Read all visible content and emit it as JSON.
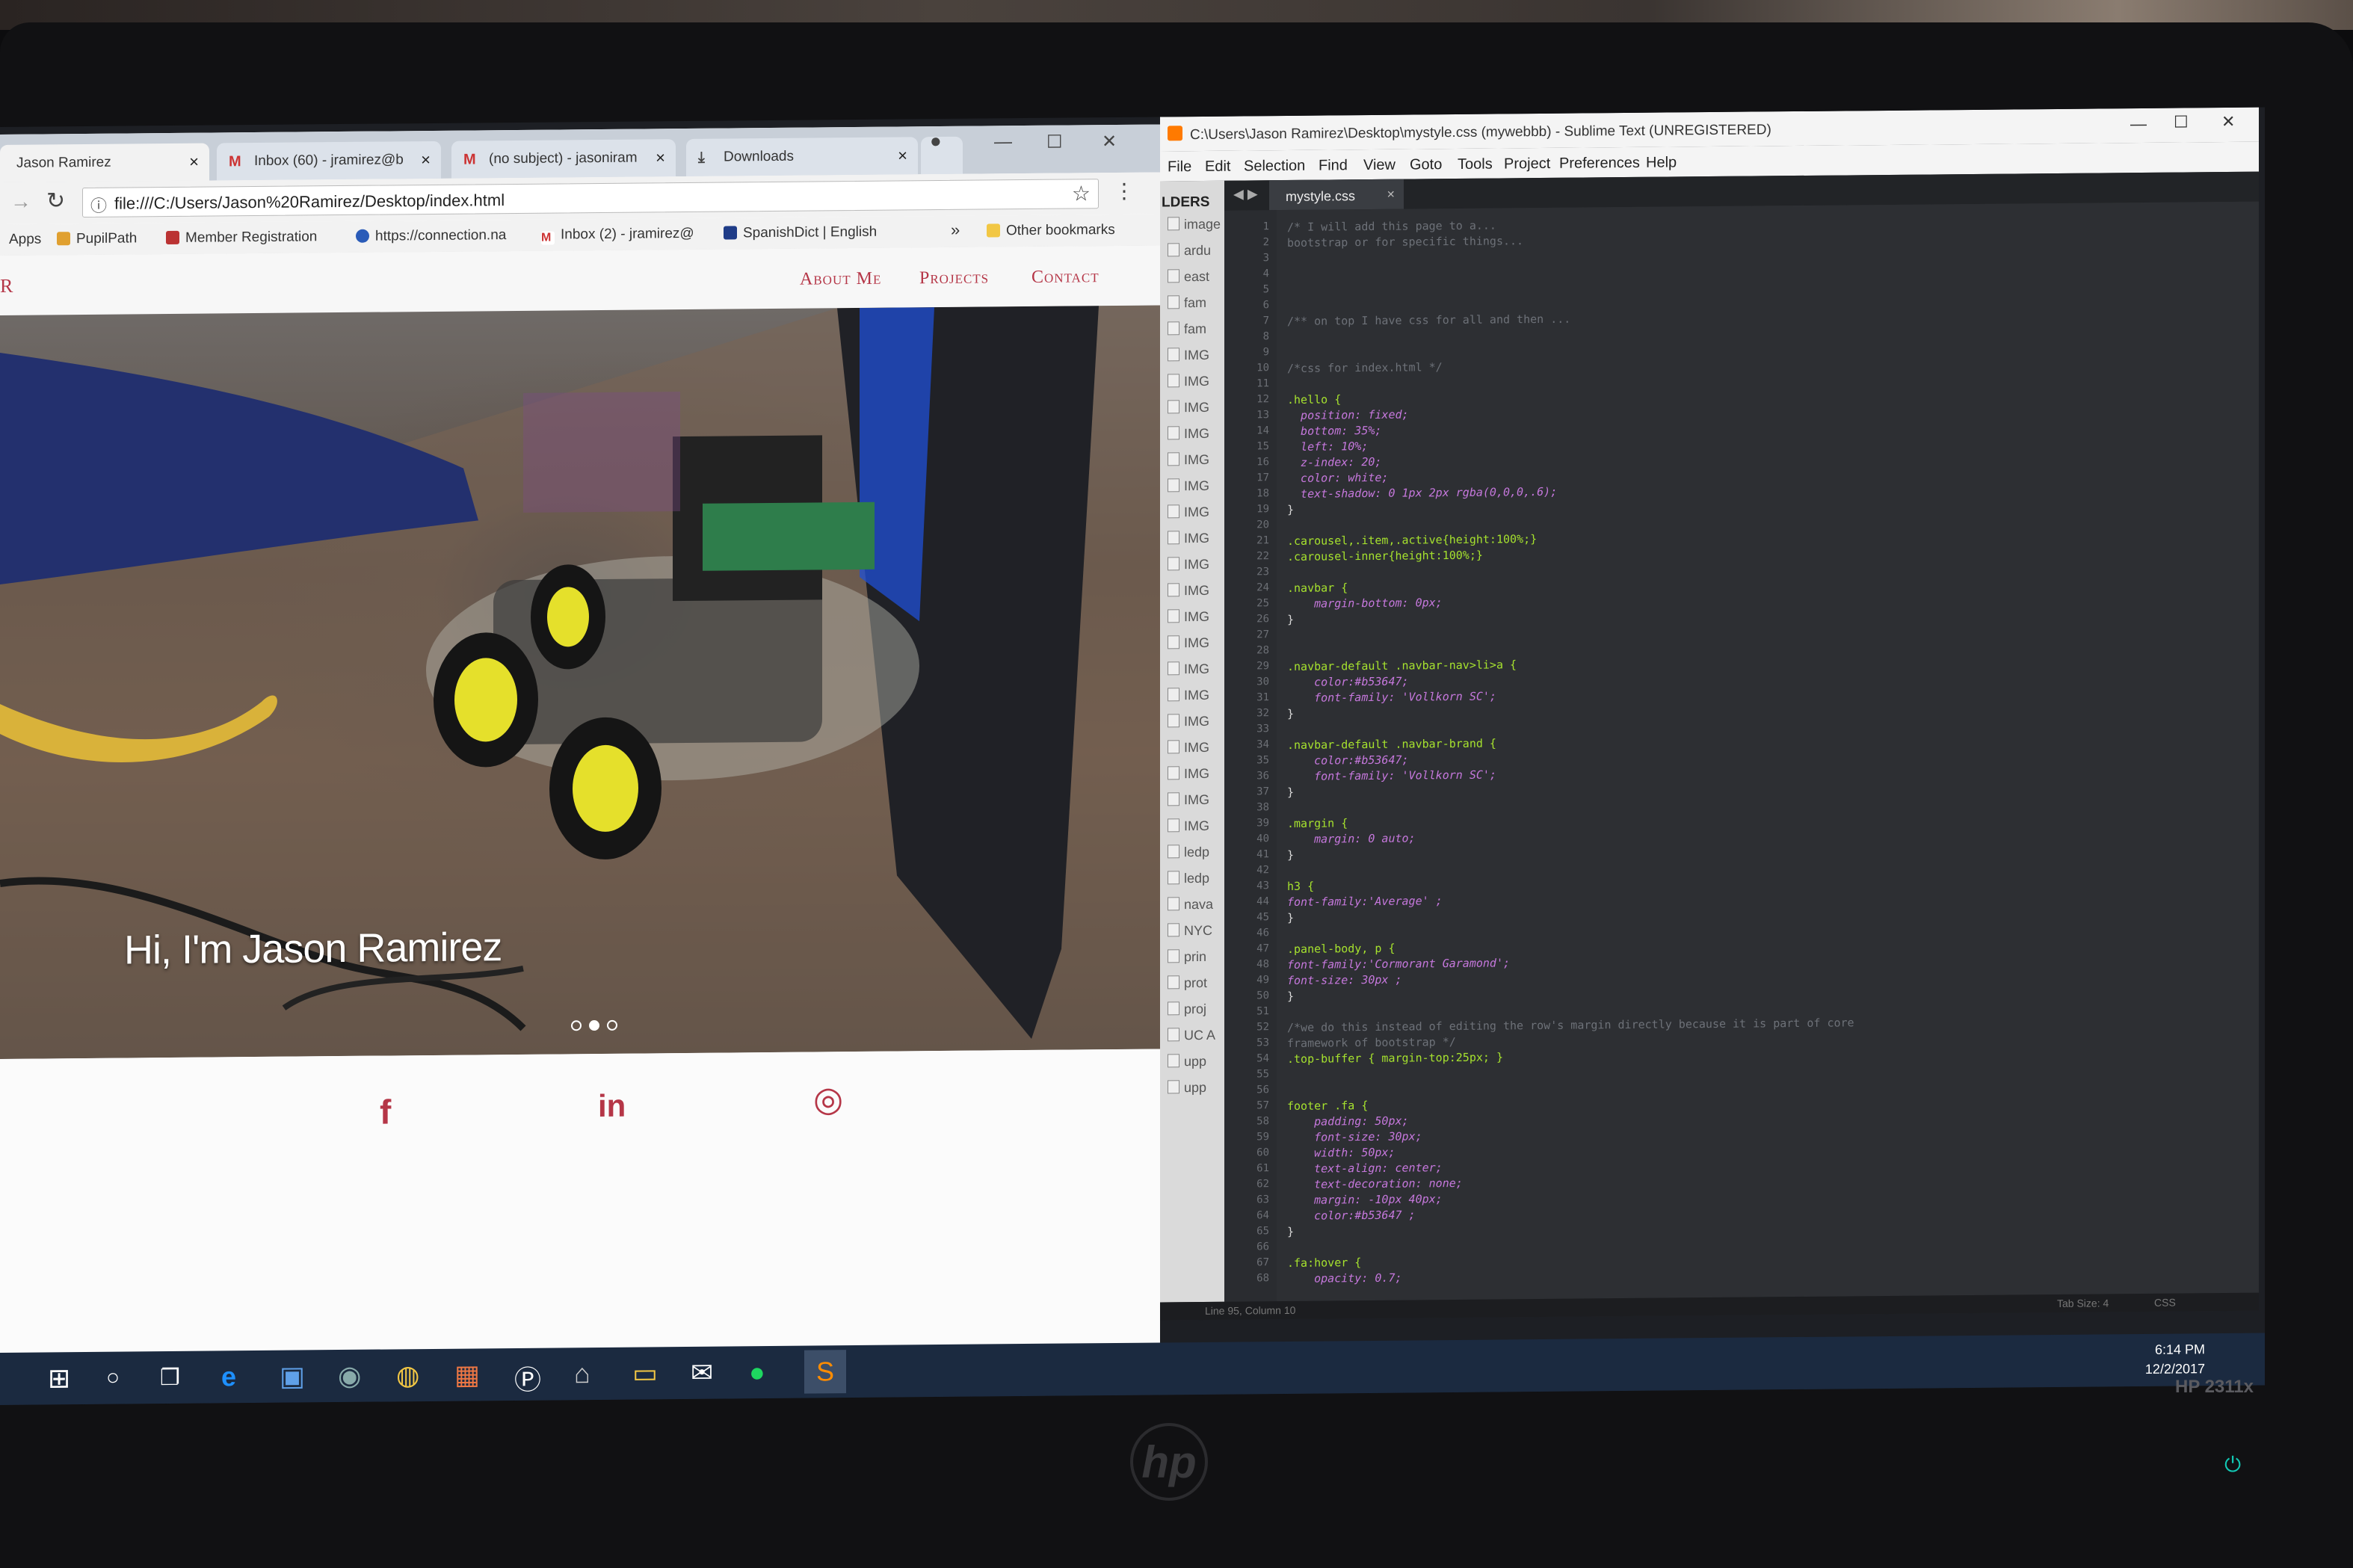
{
  "chrome": {
    "tabs": [
      {
        "label": "Jason Ramirez",
        "favicon": "page-icon",
        "active": true
      },
      {
        "label": "Inbox (60) - jramirez@b",
        "favicon": "gmail-icon"
      },
      {
        "label": "(no subject) - jasoniram",
        "favicon": "gmail-icon"
      },
      {
        "label": "Downloads",
        "favicon": "download-icon"
      }
    ],
    "url": "file:///C:/Users/Jason%20Ramirez/Desktop/index.html",
    "bookmarks": [
      {
        "label": "Apps"
      },
      {
        "label": "PupilPath"
      },
      {
        "label": "Member Registration"
      },
      {
        "label": "https://connection.na"
      },
      {
        "label": "Inbox (2) - jramirez@"
      },
      {
        "label": "SpanishDict | English"
      },
      {
        "label": "Other bookmarks"
      }
    ],
    "more_bookmarks": "»"
  },
  "site": {
    "brand": "R",
    "nav": [
      "About Me",
      "Projects",
      "Contact"
    ],
    "hero_caption": "Hi, I'm Jason Ramirez",
    "carousel_dots": 3,
    "carousel_active": 1,
    "social": [
      "facebook-icon",
      "linkedin-icon",
      "instagram-icon"
    ],
    "social_glyphs": [
      "f",
      "in",
      "◎"
    ]
  },
  "sublime": {
    "title": "C:\\Users\\Jason Ramirez\\Desktop\\mystyle.css (mywebbb) - Sublime Text (UNREGISTERED)",
    "menu": [
      "File",
      "Edit",
      "Selection",
      "Find",
      "View",
      "Goto",
      "Tools",
      "Project",
      "Preferences",
      "Help"
    ],
    "sidebar_header": "LDERS",
    "sidebar_items": [
      "image",
      "ardu",
      "east",
      "fam",
      "fam",
      "IMG",
      "IMG",
      "IMG",
      "IMG",
      "IMG",
      "IMG",
      "IMG",
      "IMG",
      "IMG",
      "IMG",
      "IMG",
      "IMG",
      "IMG",
      "IMG",
      "IMG",
      "IMG",
      "IMG",
      "IMG",
      "IMG",
      "ledp",
      "ledp",
      "nava",
      "NYC",
      "prin",
      "prot",
      "proj",
      "UC A",
      "upp",
      "upp"
    ],
    "active_tab": "mystyle.css",
    "code_lines": [
      {
        "n": "1",
        "t": "/* I will add this page to a...",
        "k": "cm"
      },
      {
        "n": "2",
        "t": "bootstrap or for specific things...",
        "k": "cm"
      },
      {
        "n": "3",
        "t": "",
        "k": ""
      },
      {
        "n": "4",
        "t": "",
        "k": ""
      },
      {
        "n": "5",
        "t": "",
        "k": ""
      },
      {
        "n": "6",
        "t": "",
        "k": ""
      },
      {
        "n": "7",
        "t": "/** on top I have css for all and then ...",
        "k": "cm"
      },
      {
        "n": "8",
        "t": "",
        "k": ""
      },
      {
        "n": "9",
        "t": "",
        "k": ""
      },
      {
        "n": "10",
        "t": "/*css for index.html */",
        "k": "cm"
      },
      {
        "n": "11",
        "t": "",
        "k": ""
      },
      {
        "n": "12",
        "t": ".hello {",
        "k": "sel"
      },
      {
        "n": "13",
        "t": "  position: fixed;",
        "k": "prop"
      },
      {
        "n": "14",
        "t": "  bottom: 35%;",
        "k": "prop"
      },
      {
        "n": "15",
        "t": "  left: 10%;",
        "k": "prop"
      },
      {
        "n": "16",
        "t": "  z-index: 20;",
        "k": "prop"
      },
      {
        "n": "17",
        "t": "  color: white;",
        "k": "prop"
      },
      {
        "n": "18",
        "t": "  text-shadow: 0 1px 2px rgba(0,0,0,.6);",
        "k": "prop"
      },
      {
        "n": "19",
        "t": "}",
        "k": ""
      },
      {
        "n": "20",
        "t": "",
        "k": ""
      },
      {
        "n": "21",
        "t": ".carousel,.item,.active{height:100%;}",
        "k": "sel"
      },
      {
        "n": "22",
        "t": ".carousel-inner{height:100%;}",
        "k": "sel"
      },
      {
        "n": "23",
        "t": "",
        "k": ""
      },
      {
        "n": "24",
        "t": ".navbar {",
        "k": "sel"
      },
      {
        "n": "25",
        "t": "    margin-bottom: 0px;",
        "k": "prop"
      },
      {
        "n": "26",
        "t": "}",
        "k": ""
      },
      {
        "n": "27",
        "t": "",
        "k": ""
      },
      {
        "n": "28",
        "t": "",
        "k": ""
      },
      {
        "n": "29",
        "t": ".navbar-default .navbar-nav>li>a {",
        "k": "sel"
      },
      {
        "n": "30",
        "t": "    color:#b53647;",
        "k": "prop"
      },
      {
        "n": "31",
        "t": "    font-family: 'Vollkorn SC';",
        "k": "prop"
      },
      {
        "n": "32",
        "t": "}",
        "k": ""
      },
      {
        "n": "33",
        "t": "",
        "k": ""
      },
      {
        "n": "34",
        "t": ".navbar-default .navbar-brand {",
        "k": "sel"
      },
      {
        "n": "35",
        "t": "    color:#b53647;",
        "k": "prop"
      },
      {
        "n": "36",
        "t": "    font-family: 'Vollkorn SC';",
        "k": "prop"
      },
      {
        "n": "37",
        "t": "}",
        "k": ""
      },
      {
        "n": "38",
        "t": "",
        "k": ""
      },
      {
        "n": "39",
        "t": ".margin {",
        "k": "sel"
      },
      {
        "n": "40",
        "t": "    margin: 0 auto;",
        "k": "prop"
      },
      {
        "n": "41",
        "t": "}",
        "k": ""
      },
      {
        "n": "42",
        "t": "",
        "k": ""
      },
      {
        "n": "43",
        "t": "h3 {",
        "k": "sel"
      },
      {
        "n": "44",
        "t": "font-family:'Average' ;",
        "k": "prop"
      },
      {
        "n": "45",
        "t": "}",
        "k": ""
      },
      {
        "n": "46",
        "t": "",
        "k": ""
      },
      {
        "n": "47",
        "t": ".panel-body, p {",
        "k": "sel"
      },
      {
        "n": "48",
        "t": "font-family:'Cormorant Garamond';",
        "k": "prop"
      },
      {
        "n": "49",
        "t": "font-size: 30px ;",
        "k": "prop"
      },
      {
        "n": "50",
        "t": "}",
        "k": ""
      },
      {
        "n": "51",
        "t": "",
        "k": ""
      },
      {
        "n": "52",
        "t": "/*we do this instead of editing the row's margin directly because it is part of core",
        "k": "cm"
      },
      {
        "n": "53",
        "t": "framework of bootstrap */",
        "k": "cm"
      },
      {
        "n": "54",
        "t": ".top-buffer { margin-top:25px; }",
        "k": "sel"
      },
      {
        "n": "55",
        "t": "",
        "k": ""
      },
      {
        "n": "56",
        "t": "",
        "k": ""
      },
      {
        "n": "57",
        "t": "footer .fa {",
        "k": "sel"
      },
      {
        "n": "58",
        "t": "    padding: 50px;",
        "k": "prop"
      },
      {
        "n": "59",
        "t": "    font-size: 30px;",
        "k": "prop"
      },
      {
        "n": "60",
        "t": "    width: 50px;",
        "k": "prop"
      },
      {
        "n": "61",
        "t": "    text-align: center;",
        "k": "prop"
      },
      {
        "n": "62",
        "t": "    text-decoration: none;",
        "k": "prop"
      },
      {
        "n": "63",
        "t": "    margin: -10px 40px;",
        "k": "prop"
      },
      {
        "n": "64",
        "t": "    color:#b53647 ;",
        "k": "prop"
      },
      {
        "n": "65",
        "t": "}",
        "k": ""
      },
      {
        "n": "66",
        "t": "",
        "k": ""
      },
      {
        "n": "67",
        "t": ".fa:hover {",
        "k": "sel"
      },
      {
        "n": "68",
        "t": "    opacity: 0.7;",
        "k": "prop"
      }
    ],
    "status_left": "Line 95, Column 10",
    "status_right_tab": "Tab Size: 4",
    "status_right_syntax": "CSS"
  },
  "taskbar": {
    "time": "6:14 PM",
    "date": "12/2/2017"
  },
  "monitor": {
    "brand": "hp",
    "model": "HP 2311x"
  },
  "colors": {
    "accent": "#b53647",
    "taskbar": "#1b2a40"
  }
}
